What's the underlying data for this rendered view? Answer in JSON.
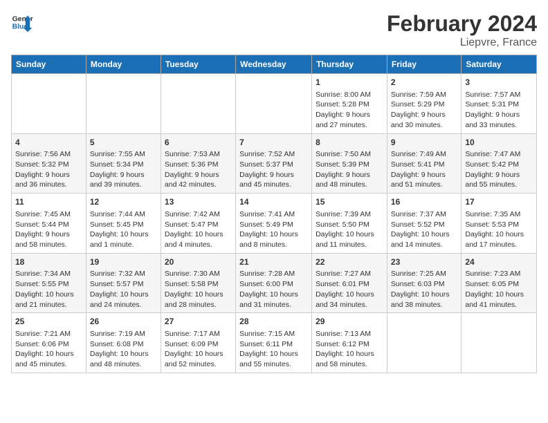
{
  "header": {
    "logo_line1": "General",
    "logo_line2": "Blue",
    "month": "February 2024",
    "location": "Liepvre, France"
  },
  "weekdays": [
    "Sunday",
    "Monday",
    "Tuesday",
    "Wednesday",
    "Thursday",
    "Friday",
    "Saturday"
  ],
  "weeks": [
    [
      {
        "day": "",
        "info": ""
      },
      {
        "day": "",
        "info": ""
      },
      {
        "day": "",
        "info": ""
      },
      {
        "day": "",
        "info": ""
      },
      {
        "day": "1",
        "info": "Sunrise: 8:00 AM\nSunset: 5:28 PM\nDaylight: 9 hours and 27 minutes."
      },
      {
        "day": "2",
        "info": "Sunrise: 7:59 AM\nSunset: 5:29 PM\nDaylight: 9 hours and 30 minutes."
      },
      {
        "day": "3",
        "info": "Sunrise: 7:57 AM\nSunset: 5:31 PM\nDaylight: 9 hours and 33 minutes."
      }
    ],
    [
      {
        "day": "4",
        "info": "Sunrise: 7:56 AM\nSunset: 5:32 PM\nDaylight: 9 hours and 36 minutes."
      },
      {
        "day": "5",
        "info": "Sunrise: 7:55 AM\nSunset: 5:34 PM\nDaylight: 9 hours and 39 minutes."
      },
      {
        "day": "6",
        "info": "Sunrise: 7:53 AM\nSunset: 5:36 PM\nDaylight: 9 hours and 42 minutes."
      },
      {
        "day": "7",
        "info": "Sunrise: 7:52 AM\nSunset: 5:37 PM\nDaylight: 9 hours and 45 minutes."
      },
      {
        "day": "8",
        "info": "Sunrise: 7:50 AM\nSunset: 5:39 PM\nDaylight: 9 hours and 48 minutes."
      },
      {
        "day": "9",
        "info": "Sunrise: 7:49 AM\nSunset: 5:41 PM\nDaylight: 9 hours and 51 minutes."
      },
      {
        "day": "10",
        "info": "Sunrise: 7:47 AM\nSunset: 5:42 PM\nDaylight: 9 hours and 55 minutes."
      }
    ],
    [
      {
        "day": "11",
        "info": "Sunrise: 7:45 AM\nSunset: 5:44 PM\nDaylight: 9 hours and 58 minutes."
      },
      {
        "day": "12",
        "info": "Sunrise: 7:44 AM\nSunset: 5:45 PM\nDaylight: 10 hours and 1 minute."
      },
      {
        "day": "13",
        "info": "Sunrise: 7:42 AM\nSunset: 5:47 PM\nDaylight: 10 hours and 4 minutes."
      },
      {
        "day": "14",
        "info": "Sunrise: 7:41 AM\nSunset: 5:49 PM\nDaylight: 10 hours and 8 minutes."
      },
      {
        "day": "15",
        "info": "Sunrise: 7:39 AM\nSunset: 5:50 PM\nDaylight: 10 hours and 11 minutes."
      },
      {
        "day": "16",
        "info": "Sunrise: 7:37 AM\nSunset: 5:52 PM\nDaylight: 10 hours and 14 minutes."
      },
      {
        "day": "17",
        "info": "Sunrise: 7:35 AM\nSunset: 5:53 PM\nDaylight: 10 hours and 17 minutes."
      }
    ],
    [
      {
        "day": "18",
        "info": "Sunrise: 7:34 AM\nSunset: 5:55 PM\nDaylight: 10 hours and 21 minutes."
      },
      {
        "day": "19",
        "info": "Sunrise: 7:32 AM\nSunset: 5:57 PM\nDaylight: 10 hours and 24 minutes."
      },
      {
        "day": "20",
        "info": "Sunrise: 7:30 AM\nSunset: 5:58 PM\nDaylight: 10 hours and 28 minutes."
      },
      {
        "day": "21",
        "info": "Sunrise: 7:28 AM\nSunset: 6:00 PM\nDaylight: 10 hours and 31 minutes."
      },
      {
        "day": "22",
        "info": "Sunrise: 7:27 AM\nSunset: 6:01 PM\nDaylight: 10 hours and 34 minutes."
      },
      {
        "day": "23",
        "info": "Sunrise: 7:25 AM\nSunset: 6:03 PM\nDaylight: 10 hours and 38 minutes."
      },
      {
        "day": "24",
        "info": "Sunrise: 7:23 AM\nSunset: 6:05 PM\nDaylight: 10 hours and 41 minutes."
      }
    ],
    [
      {
        "day": "25",
        "info": "Sunrise: 7:21 AM\nSunset: 6:06 PM\nDaylight: 10 hours and 45 minutes."
      },
      {
        "day": "26",
        "info": "Sunrise: 7:19 AM\nSunset: 6:08 PM\nDaylight: 10 hours and 48 minutes."
      },
      {
        "day": "27",
        "info": "Sunrise: 7:17 AM\nSunset: 6:09 PM\nDaylight: 10 hours and 52 minutes."
      },
      {
        "day": "28",
        "info": "Sunrise: 7:15 AM\nSunset: 6:11 PM\nDaylight: 10 hours and 55 minutes."
      },
      {
        "day": "29",
        "info": "Sunrise: 7:13 AM\nSunset: 6:12 PM\nDaylight: 10 hours and 58 minutes."
      },
      {
        "day": "",
        "info": ""
      },
      {
        "day": "",
        "info": ""
      }
    ]
  ]
}
